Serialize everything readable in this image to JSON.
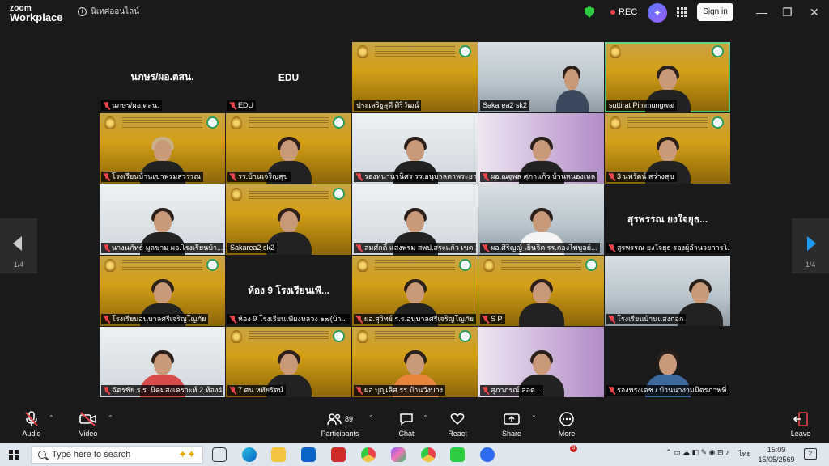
{
  "titlebar": {
    "brand_top": "zoom",
    "brand_bottom": "Workplace",
    "meeting_info": "นิเทศออนไลน์",
    "rec_label": "REC",
    "signin_label": "Sign in",
    "minimize": "—",
    "maximize": "❐",
    "close": "✕"
  },
  "gallery": {
    "page_left": "1/4",
    "page_right": "1/4",
    "tiles": [
      {
        "name": "นภษร/ผอ.ตสน.",
        "big": "นภษร/ผอ.ตสน."
      },
      {
        "name": "EDU",
        "big": "EDU"
      },
      {
        "name": "ประเสริฐสุดี ศิริวัฒน์"
      },
      {
        "name": "Sakarea2 sk2"
      },
      {
        "name": "suttirat Pimmungwai"
      },
      {
        "name": "โรงเรียนบ้านเขาพรมสุวรรณ"
      },
      {
        "name": "รร.บ้านเจริญสุข"
      },
      {
        "name": "รองหนานานิศร รร.อนุบาลตาพระยา"
      },
      {
        "name": "ผอ.ณฐพล ศุภาแก้ว บ้านหนองเหล"
      },
      {
        "name": "3 นพรัตน์ สว่างสุข"
      },
      {
        "name": "นางนภัทธ์ มูลขาม ผอ.โรงเรียนบ้า..."
      },
      {
        "name": "Sakarea2 sk2"
      },
      {
        "name": "สมศักดิ์ แสงพรม สพป.สระแก้ว เขต 2"
      },
      {
        "name": "ผอ.ศิริญญ์ เย็นจิต รร.กองไพบูลย์..."
      },
      {
        "name": "สุรพรรณ ยงใจยุธ รองผู้อำนวยการโ...",
        "big": "สุรพรรณ ยงใจยุธ..."
      },
      {
        "name": "โรงเรียนอนุบาลศรีเจริญโญภัย"
      },
      {
        "name": "ห้อง 9 โรงเรียนเพียงหลวง ๑๗(บ้า...",
        "big": "ห้อง 9 โรงเรียนเพี..."
      },
      {
        "name": "ผอ.สุวิทย์ ร.ร.อนุบาลศรีเจริญโญภัย"
      },
      {
        "name": "S P"
      },
      {
        "name": "โรงเรียนบ้านแสงกอก"
      },
      {
        "name": "ฉัตรชัย ร.ร. นิคมสงเคราะห์ 2 ห้อง4"
      },
      {
        "name": "7 ศน.หทัยรัตน์"
      },
      {
        "name": "ผอ.บุญเลิศ รร.บ้านวังบาง"
      },
      {
        "name": "สุภาภรณ์ ลอต..."
      },
      {
        "name": "รองทรงเดช / บ้านนางามมิตรภาพที่..."
      }
    ]
  },
  "toolbar": {
    "audio": "Audio",
    "video": "Video",
    "participants": "Participants",
    "participant_count": "89",
    "chat": "Chat",
    "react": "React",
    "share": "Share",
    "more": "More",
    "leave": "Leave"
  },
  "taskbar": {
    "search_placeholder": "Type here to search",
    "mail_badge": "3",
    "lang": "ไทย",
    "time": "15:09",
    "date": "15/05/2569",
    "notifications": "2"
  },
  "colors": {
    "accent_green": "#3ec26b",
    "muted_red": "#e8424a",
    "nav_arrow_blue": "#1e9bf0"
  }
}
